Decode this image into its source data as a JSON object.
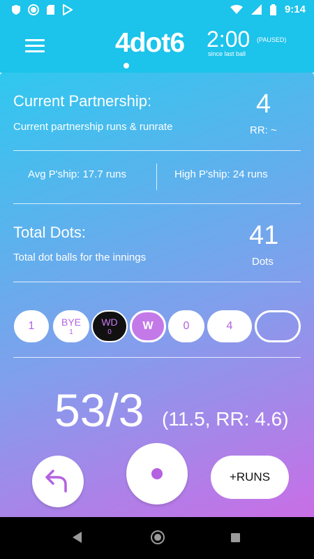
{
  "status_bar": {
    "time": "9:14",
    "icons": [
      "shield-icon",
      "circle-icon",
      "sd-card-icon",
      "play-store-icon",
      "wifi-icon",
      "signal-icon",
      "battery-icon"
    ]
  },
  "app_bar": {
    "logo": "4dot6",
    "timer": "2:00",
    "timer_state": "(PAUSED)",
    "timer_caption": "since last ball"
  },
  "partnership": {
    "title": "Current Partnership:",
    "description": "Current partnership runs & runrate",
    "runs": "4",
    "runrate": "RR: ~",
    "avg": "Avg P'ship: 17.7 runs",
    "high": "High P'ship: 24 runs"
  },
  "dots": {
    "title": "Total Dots:",
    "description": "Total dot balls for the innings",
    "count": "41",
    "unit": "Dots"
  },
  "over_balls": [
    {
      "label": "1",
      "extra": "",
      "style": "plain"
    },
    {
      "label": "BYE",
      "extra": "1",
      "style": "plain"
    },
    {
      "label": "WD",
      "extra": "0",
      "style": "black"
    },
    {
      "label": "W",
      "extra": "",
      "style": "wicket"
    },
    {
      "label": "0",
      "extra": "",
      "style": "plain"
    },
    {
      "label": "4",
      "extra": "",
      "style": "plain"
    },
    {
      "label": "",
      "extra": "",
      "style": "empty"
    }
  ],
  "score": {
    "main": "53/3",
    "detail": "(11.5, RR: 4.6)"
  },
  "actions": {
    "runs_label": "+RUNS"
  },
  "colors": {
    "header": "#1cc3ea",
    "gradient_start": "#2fc8ee",
    "gradient_end": "#c96ee6",
    "accent": "#b362e0"
  }
}
